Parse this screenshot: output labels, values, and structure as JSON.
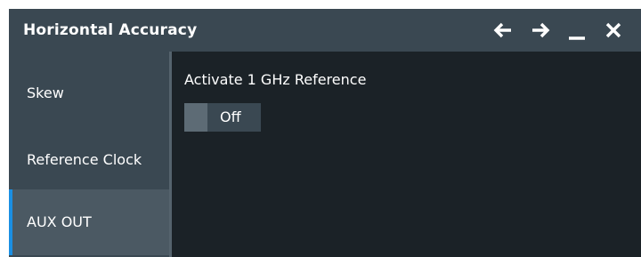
{
  "dialog": {
    "title": "Horizontal Accuracy",
    "controls": [
      {
        "name": "back-arrow-icon",
        "icon": "arrow-left"
      },
      {
        "name": "forward-arrow-icon",
        "icon": "arrow-right"
      },
      {
        "name": "minimize-icon",
        "icon": "minimize"
      },
      {
        "name": "close-icon",
        "icon": "close"
      }
    ]
  },
  "sidebar": {
    "items": [
      {
        "label": "Skew",
        "active": false
      },
      {
        "label": "Reference Clock",
        "active": false
      },
      {
        "label": "AUX OUT",
        "active": true
      }
    ]
  },
  "content": {
    "activate_reference": {
      "label": "Activate 1 GHz Reference",
      "value": "Off"
    }
  },
  "colors": {
    "background": "#1b2227",
    "panel": "#3a4852",
    "active_item": "#4b5963",
    "accent": "#1a8fe3",
    "text": "#ffffff"
  }
}
